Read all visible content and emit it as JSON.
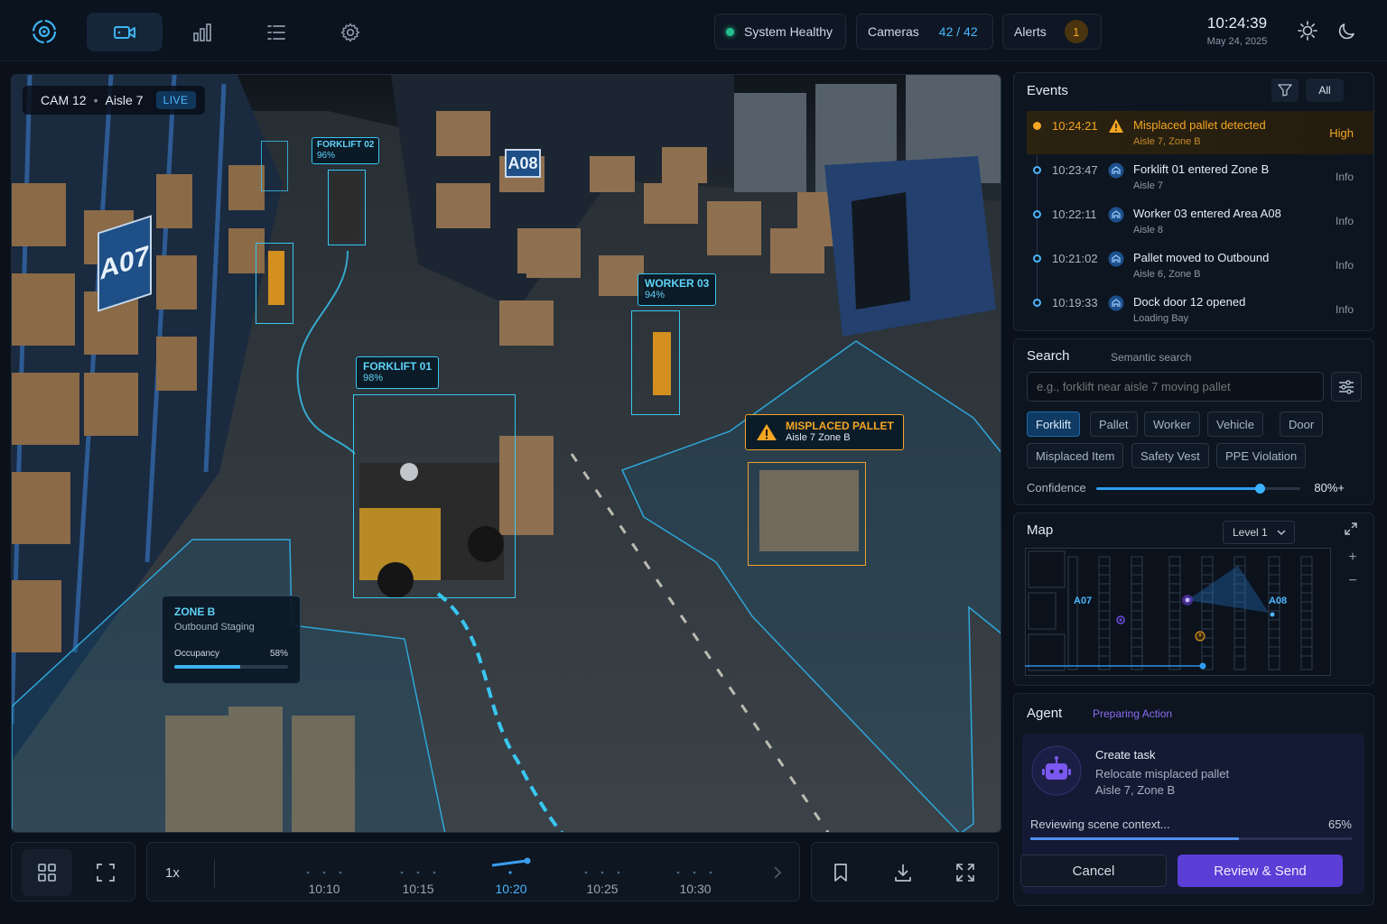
{
  "header": {
    "nav": [
      "video-tab",
      "analytics-tab",
      "list-tab",
      "settings-tab"
    ],
    "system_status": "System Healthy",
    "cameras_label": "Cameras",
    "cameras_count": "42 / 42",
    "alerts_label": "Alerts",
    "alerts_count": "1",
    "time": "10:24:39",
    "date": "May 24, 2025"
  },
  "video": {
    "camera": "CAM 12",
    "aisle": "Aisle 7",
    "live": "LIVE",
    "signs": [
      "A07",
      "A08"
    ],
    "detections": [
      {
        "label": "FORKLIFT 02",
        "conf": "96%"
      },
      {
        "label": "WORKER 03",
        "conf": "94%"
      },
      {
        "label": "FORKLIFT 01",
        "conf": "98%"
      }
    ],
    "alert_tag": {
      "title": "MISPLACED PALLET",
      "sub": "Aisle 7 Zone B"
    },
    "zone": {
      "title": "ZONE B",
      "sub": "Outbound Staging",
      "occupancy_label": "Occupancy",
      "occupancy": "58%",
      "occupancy_value": 0.58
    }
  },
  "timeline": {
    "speed": "1x",
    "ticks": [
      "10:10",
      "10:15",
      "10:20",
      "10:25",
      "10:30"
    ],
    "current": "10:20"
  },
  "events": {
    "title": "Events",
    "filter": "All",
    "items": [
      {
        "time": "10:24:21",
        "title": "Misplaced pallet detected",
        "sub": "Aisle 7, Zone B",
        "severity": "High"
      },
      {
        "time": "10:23:47",
        "title": "Forklift 01 entered Zone B",
        "sub": "Aisle 7",
        "severity": "Info"
      },
      {
        "time": "10:22:11",
        "title": "Worker 03 entered Area A08",
        "sub": "Aisle 8",
        "severity": "Info"
      },
      {
        "time": "10:21:02",
        "title": "Pallet moved to Outbound",
        "sub": "Aisle 6, Zone B",
        "severity": "Info"
      },
      {
        "time": "10:19:33",
        "title": "Dock door 12 opened",
        "sub": "Loading Bay",
        "severity": "Info"
      }
    ]
  },
  "search": {
    "title": "Search",
    "subtitle": "Semantic search",
    "placeholder": "e.g., forklift near aisle 7 moving pallet",
    "chips": [
      "Forklift",
      "Pallet",
      "Worker",
      "Vehicle",
      "Door",
      "Misplaced Item",
      "Safety Vest",
      "PPE Violation"
    ],
    "active_chip": "Forklift",
    "confidence_label": "Confidence",
    "confidence": "80%+",
    "confidence_value": 0.8
  },
  "map": {
    "title": "Map",
    "level": "Level 1",
    "labels": [
      "A07",
      "A08"
    ]
  },
  "agent": {
    "title": "Agent",
    "status": "Preparing Action",
    "task_title": "Create task",
    "task_line1": "Relocate misplaced pallet",
    "task_line2": "Aisle 7, Zone B",
    "progress_label": "Reviewing scene context...",
    "progress": "65%",
    "progress_value": 0.65,
    "cancel": "Cancel",
    "send": "Review & Send"
  },
  "colors": {
    "accent": "#39c6f0",
    "alert": "#f5a623",
    "agent": "#5b3ed6",
    "healthy": "#22c08d"
  }
}
